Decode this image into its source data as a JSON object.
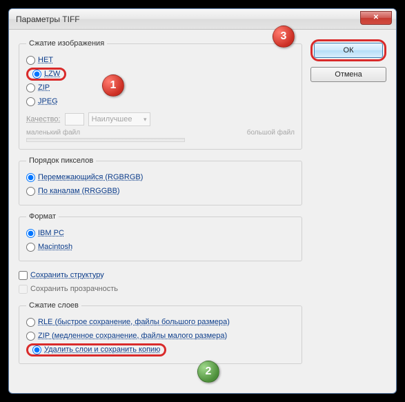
{
  "window": {
    "title": "Параметры TIFF"
  },
  "buttons": {
    "ok": "ОК",
    "cancel": "Отмена",
    "close_glyph": "✕"
  },
  "compression": {
    "legend": "Сжатие изображения",
    "none": "НЕТ",
    "lzw": "LZW",
    "zip": "ZIP",
    "jpeg": "JPEG",
    "quality_label": "Качество:",
    "quality_preset": "Наилучшее",
    "slider_small": "маленький файл",
    "slider_big": "большой файл"
  },
  "pixel_order": {
    "legend": "Порядок пикселов",
    "interleaved": "Перемежающийся (RGBRGB)",
    "per_channel": "По каналам (RRGGBB)"
  },
  "format": {
    "legend": "Формат",
    "ibm": "IBM PC",
    "mac": "Macintosh"
  },
  "save_structure": "Сохранить структуру",
  "save_transparency": "Сохранить прозрачность",
  "layer_compression": {
    "legend": "Сжатие слоев",
    "rle": "RLE (быстрое сохранение, файлы большого размера)",
    "zip": "ZIP (медленное сохранение, файлы малого размера)",
    "discard": "Удалить слои и сохранить копию"
  },
  "callouts": {
    "one": "1",
    "two": "2",
    "three": "3"
  }
}
